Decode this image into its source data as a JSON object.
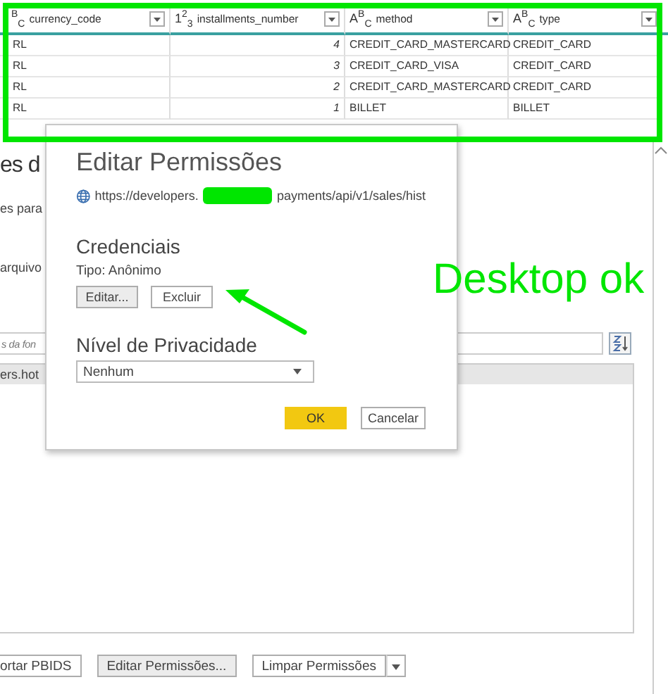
{
  "grid": {
    "columns": [
      {
        "type_label": "$^{B}$$_{C}$",
        "name": "currency_code"
      },
      {
        "type_label": "1$^{2}$$_{3}$",
        "name": "installments_number"
      },
      {
        "type_label": "A$^{B}$$_{C}$",
        "name": "method"
      },
      {
        "type_label": "A$^{B}$$_{C}$",
        "name": "type"
      }
    ],
    "rows": [
      [
        "RL",
        "4",
        "CREDIT_CARD_MASTERCARD",
        "CREDIT_CARD"
      ],
      [
        "RL",
        "3",
        "CREDIT_CARD_VISA",
        "CREDIT_CARD"
      ],
      [
        "RL",
        "2",
        "CREDIT_CARD_MASTERCARD",
        "CREDIT_CARD"
      ],
      [
        "RL",
        "1",
        "BILLET",
        "BILLET"
      ]
    ]
  },
  "background_window": {
    "title": "es d",
    "subtitle": "es para",
    "section_label": "arquivo",
    "search": {
      "placeholder": "s da fon"
    },
    "list_items": [
      {
        "label": "ers.hot",
        "selected": true
      }
    ],
    "buttons": [
      "ortar PBIDS",
      "Editar Permissões...",
      "Limpar Permissões"
    ]
  },
  "dialog": {
    "title": "Editar Permissões",
    "url_start": "https://developers.",
    "url_end": "payments/api/v1/sales/hist",
    "credentials_heading": "Credenciais",
    "credential_type": "Tipo: Anônimo",
    "credential_buttons": [
      "Editar...",
      "Excluir"
    ],
    "privacy_heading": "Nível de Privacidade",
    "privacy_level": "Nenhum",
    "buttons": [
      {
        "label": "OK",
        "kind": "primary"
      },
      {
        "label": "Cancelar",
        "kind": "secondary"
      }
    ]
  },
  "annotation": {
    "note": "Desktop ok"
  }
}
